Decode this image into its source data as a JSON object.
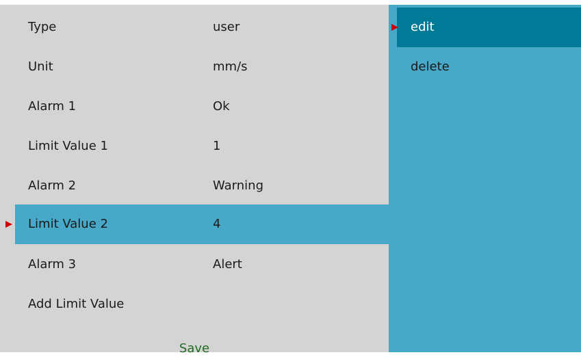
{
  "rows": [
    {
      "label": "Type",
      "value": "user"
    },
    {
      "label": "Unit",
      "value": "mm/s"
    },
    {
      "label": "Alarm 1",
      "value": "Ok"
    },
    {
      "label": "Limit Value 1",
      "value": "1"
    },
    {
      "label": "Alarm 2",
      "value": "Warning"
    },
    {
      "label": "Limit Value 2",
      "value": "4",
      "selected": true
    },
    {
      "label": "Alarm 3",
      "value": "Alert"
    },
    {
      "label": "Add Limit Value",
      "value": ""
    }
  ],
  "save_label": "Save",
  "menu": {
    "items": [
      {
        "label": "edit",
        "active": true
      },
      {
        "label": "delete",
        "active": false
      }
    ]
  },
  "colors": {
    "panel_bg": "#d4d4d4",
    "selection": "#47a8c7",
    "menu_bg": "#47a8c7",
    "menu_active": "#007a96",
    "pointer": "#cc0000",
    "save_text": "#1f6b1f"
  },
  "icons": {
    "pointer": "red-triangle-pointer-icon"
  }
}
